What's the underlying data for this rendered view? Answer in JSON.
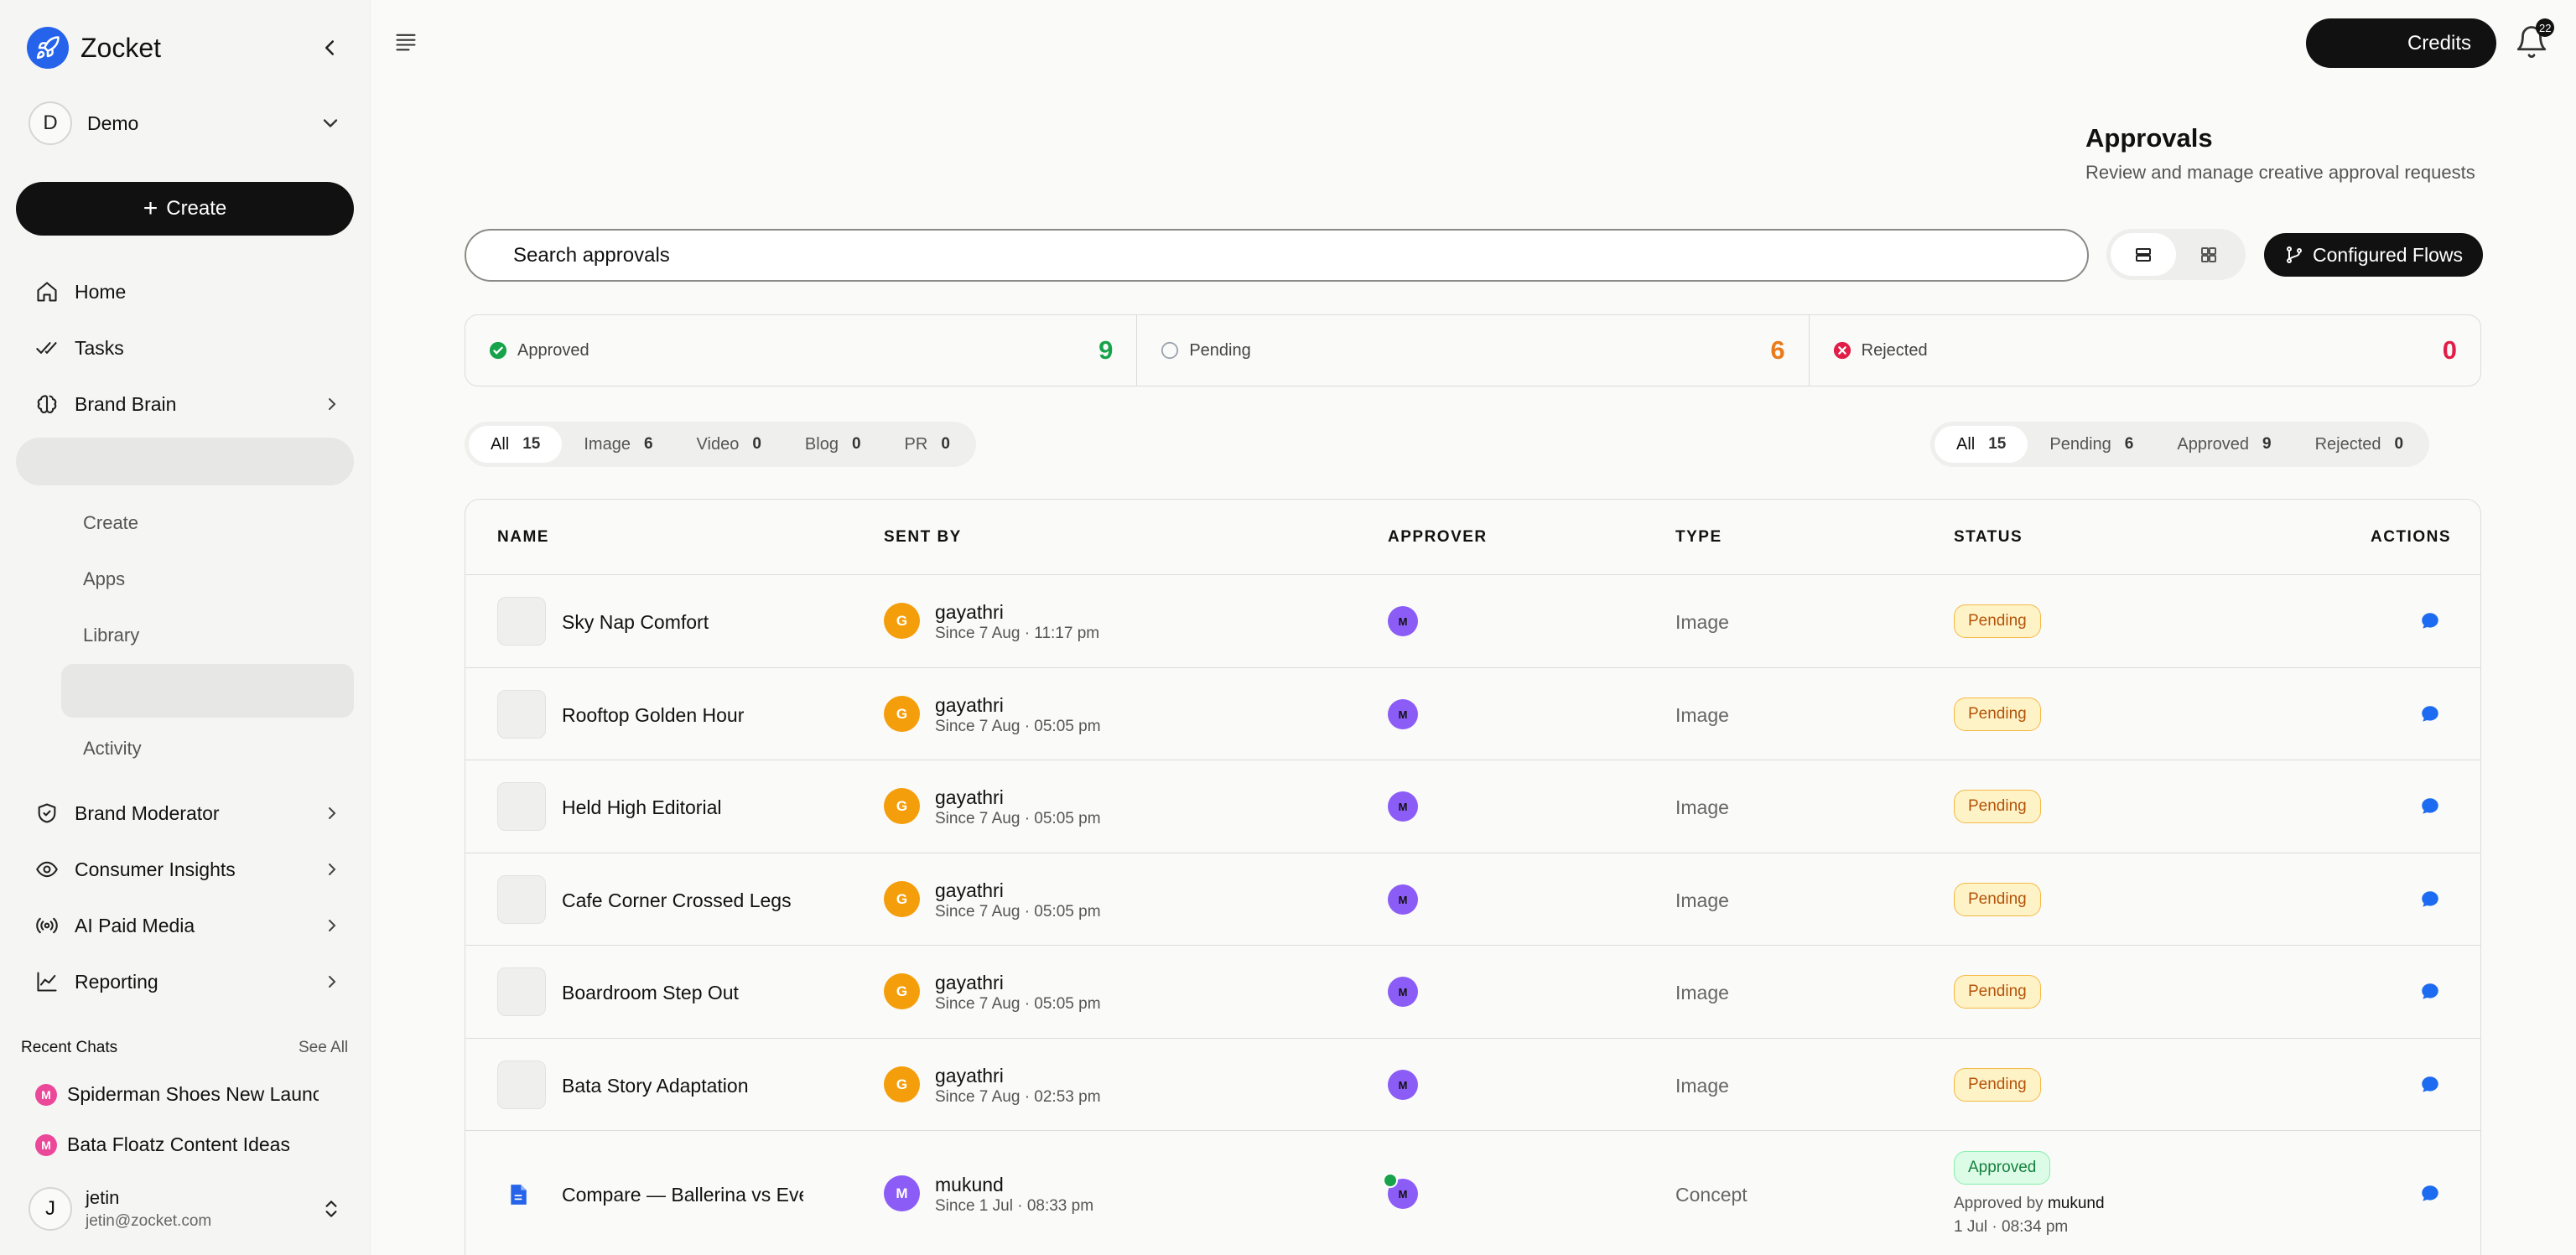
{
  "app": {
    "name": "Zocket"
  },
  "workspace": {
    "initial": "D",
    "name": "Demo"
  },
  "sidebar": {
    "create_label": "Create",
    "nav": {
      "home": "Home",
      "tasks": "Tasks",
      "brand_brain": "Brand Brain",
      "brand_moderator": "Brand Moderator",
      "consumer_insights": "Consumer Insights",
      "ai_paid_media": "AI Paid Media",
      "reporting": "Reporting"
    },
    "sub_items": {
      "create": "Create",
      "apps": "Apps",
      "library": "Library",
      "activity": "Activity"
    },
    "recent_chats_title": "Recent Chats",
    "see_all": "See All",
    "recent_chats": [
      {
        "initial": "M",
        "title": "Spiderman Shoes New Launch"
      },
      {
        "initial": "M",
        "title": "Bata Floatz Content Ideas"
      }
    ]
  },
  "user": {
    "initial": "J",
    "name": "jetin",
    "email": "jetin@zocket.com"
  },
  "topbar": {
    "credits_label": "Credits",
    "notification_count": "22"
  },
  "page": {
    "title": "Approvals",
    "subtitle": "Review and manage creative approval requests",
    "search_placeholder": "Search approvals",
    "configured_flows_label": "Configured Flows"
  },
  "stats": {
    "approved": {
      "label": "Approved",
      "value": "9",
      "color": "#16a34a"
    },
    "pending": {
      "label": "Pending",
      "value": "6",
      "color": "#ea7a1a"
    },
    "rejected": {
      "label": "Rejected",
      "value": "0",
      "color": "#e11d48"
    }
  },
  "type_filters": [
    {
      "label": "All",
      "count": "15"
    },
    {
      "label": "Image",
      "count": "6"
    },
    {
      "label": "Video",
      "count": "0"
    },
    {
      "label": "Blog",
      "count": "0"
    },
    {
      "label": "PR",
      "count": "0"
    }
  ],
  "status_filters": [
    {
      "label": "All",
      "count": "15"
    },
    {
      "label": "Pending",
      "count": "6"
    },
    {
      "label": "Approved",
      "count": "9"
    },
    {
      "label": "Rejected",
      "count": "0"
    }
  ],
  "table": {
    "headers": {
      "name": "NAME",
      "sent_by": "SENT BY",
      "approver": "APPROVER",
      "type": "TYPE",
      "status": "STATUS",
      "actions": "ACTIONS"
    },
    "rows": [
      {
        "name": "Sky Nap Comfort",
        "sender_initial": "G",
        "sender": "gayathri",
        "since": "Since 7 Aug · 11:17 pm",
        "approver_initial": "M",
        "type": "Image",
        "status": "Pending"
      },
      {
        "name": "Rooftop Golden Hour",
        "sender_initial": "G",
        "sender": "gayathri",
        "since": "Since 7 Aug · 05:05 pm",
        "approver_initial": "M",
        "type": "Image",
        "status": "Pending"
      },
      {
        "name": "Held High Editorial",
        "sender_initial": "G",
        "sender": "gayathri",
        "since": "Since 7 Aug · 05:05 pm",
        "approver_initial": "M",
        "type": "Image",
        "status": "Pending"
      },
      {
        "name": "Cafe Corner Crossed Legs",
        "sender_initial": "G",
        "sender": "gayathri",
        "since": "Since 7 Aug · 05:05 pm",
        "approver_initial": "M",
        "type": "Image",
        "status": "Pending"
      },
      {
        "name": "Boardroom Step Out",
        "sender_initial": "G",
        "sender": "gayathri",
        "since": "Since 7 Aug · 05:05 pm",
        "approver_initial": "M",
        "type": "Image",
        "status": "Pending"
      },
      {
        "name": "Bata Story Adaptation",
        "sender_initial": "G",
        "sender": "gayathri",
        "since": "Since 7 Aug · 02:53 pm",
        "approver_initial": "M",
        "type": "Image",
        "status": "Pending"
      },
      {
        "name": "Compare — Ballerina vs Everyday",
        "sender_initial": "M",
        "sender": "mukund",
        "since": "Since 1 Jul · 08:33 pm",
        "approver_initial": "M",
        "type": "Concept",
        "status": "Approved",
        "approved_by_prefix": "Approved by",
        "approved_by": "mukund",
        "approved_at": "1 Jul · 08:34 pm"
      }
    ]
  },
  "colors": {
    "accent": "#2563eb",
    "sender_gayathri": "#f59e0b",
    "sender_mukund": "#8b5cf6",
    "approver": "#8b5cf6",
    "chat_dot": "#ec4899"
  }
}
